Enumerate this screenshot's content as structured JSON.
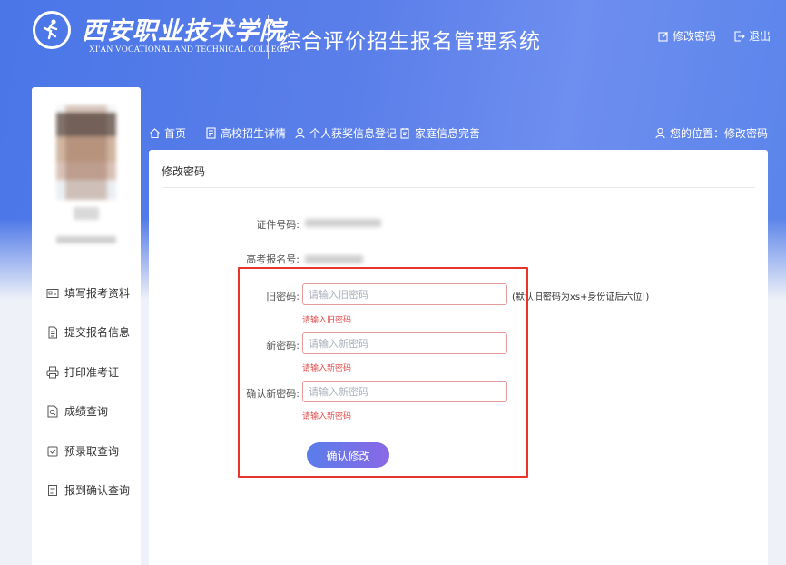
{
  "header": {
    "school_cn": "西安职业技术学院",
    "school_en": "XI'AN VOCATIONAL AND TECHNICAL COLLEGE",
    "system_title": "综合评价招生报名管理系统",
    "change_password_label": "修改密码",
    "logout_label": "退出"
  },
  "sidebar": {
    "items": [
      {
        "label": "填写报考资料",
        "icon": "id-card-icon"
      },
      {
        "label": "提交报名信息",
        "icon": "document-icon"
      },
      {
        "label": "打印准考证",
        "icon": "printer-icon"
      },
      {
        "label": "成绩查询",
        "icon": "score-icon"
      },
      {
        "label": "预录取查询",
        "icon": "admission-icon"
      },
      {
        "label": "报到确认查询",
        "icon": "checkin-icon"
      }
    ]
  },
  "nav": {
    "items": [
      {
        "label": "首页",
        "icon": "home-icon"
      },
      {
        "label": "高校招生详情",
        "icon": "doc-icon"
      },
      {
        "label": "个人获奖信息登记",
        "icon": "user-icon"
      },
      {
        "label": "家庭信息完善",
        "icon": "family-icon"
      }
    ],
    "breadcrumb": "您的位置：修改密码"
  },
  "form": {
    "title": "修改密码",
    "id_label": "证件号码:",
    "exam_no_label": "高考报名号:",
    "old_label": "旧密码:",
    "old_placeholder": "请输入旧密码",
    "old_error": "请输入旧密码",
    "old_hint": "(默认旧密码为xs+身份证后六位!)",
    "new_label": "新密码:",
    "new_placeholder": "请输入新密码",
    "new_error": "请输入新密码",
    "confirm_label": "确认新密码:",
    "confirm_placeholder": "请输入新密码",
    "confirm_error": "请输入新密码",
    "submit_label": "确认修改"
  },
  "colors": {
    "header_gradient_start": "#4a76e8",
    "header_gradient_end": "#6e8ef0",
    "error_red": "#e24b4b",
    "highlight_red": "#e8342b",
    "button_gradient_start": "#5a7dea",
    "button_gradient_end": "#8a68e6"
  }
}
